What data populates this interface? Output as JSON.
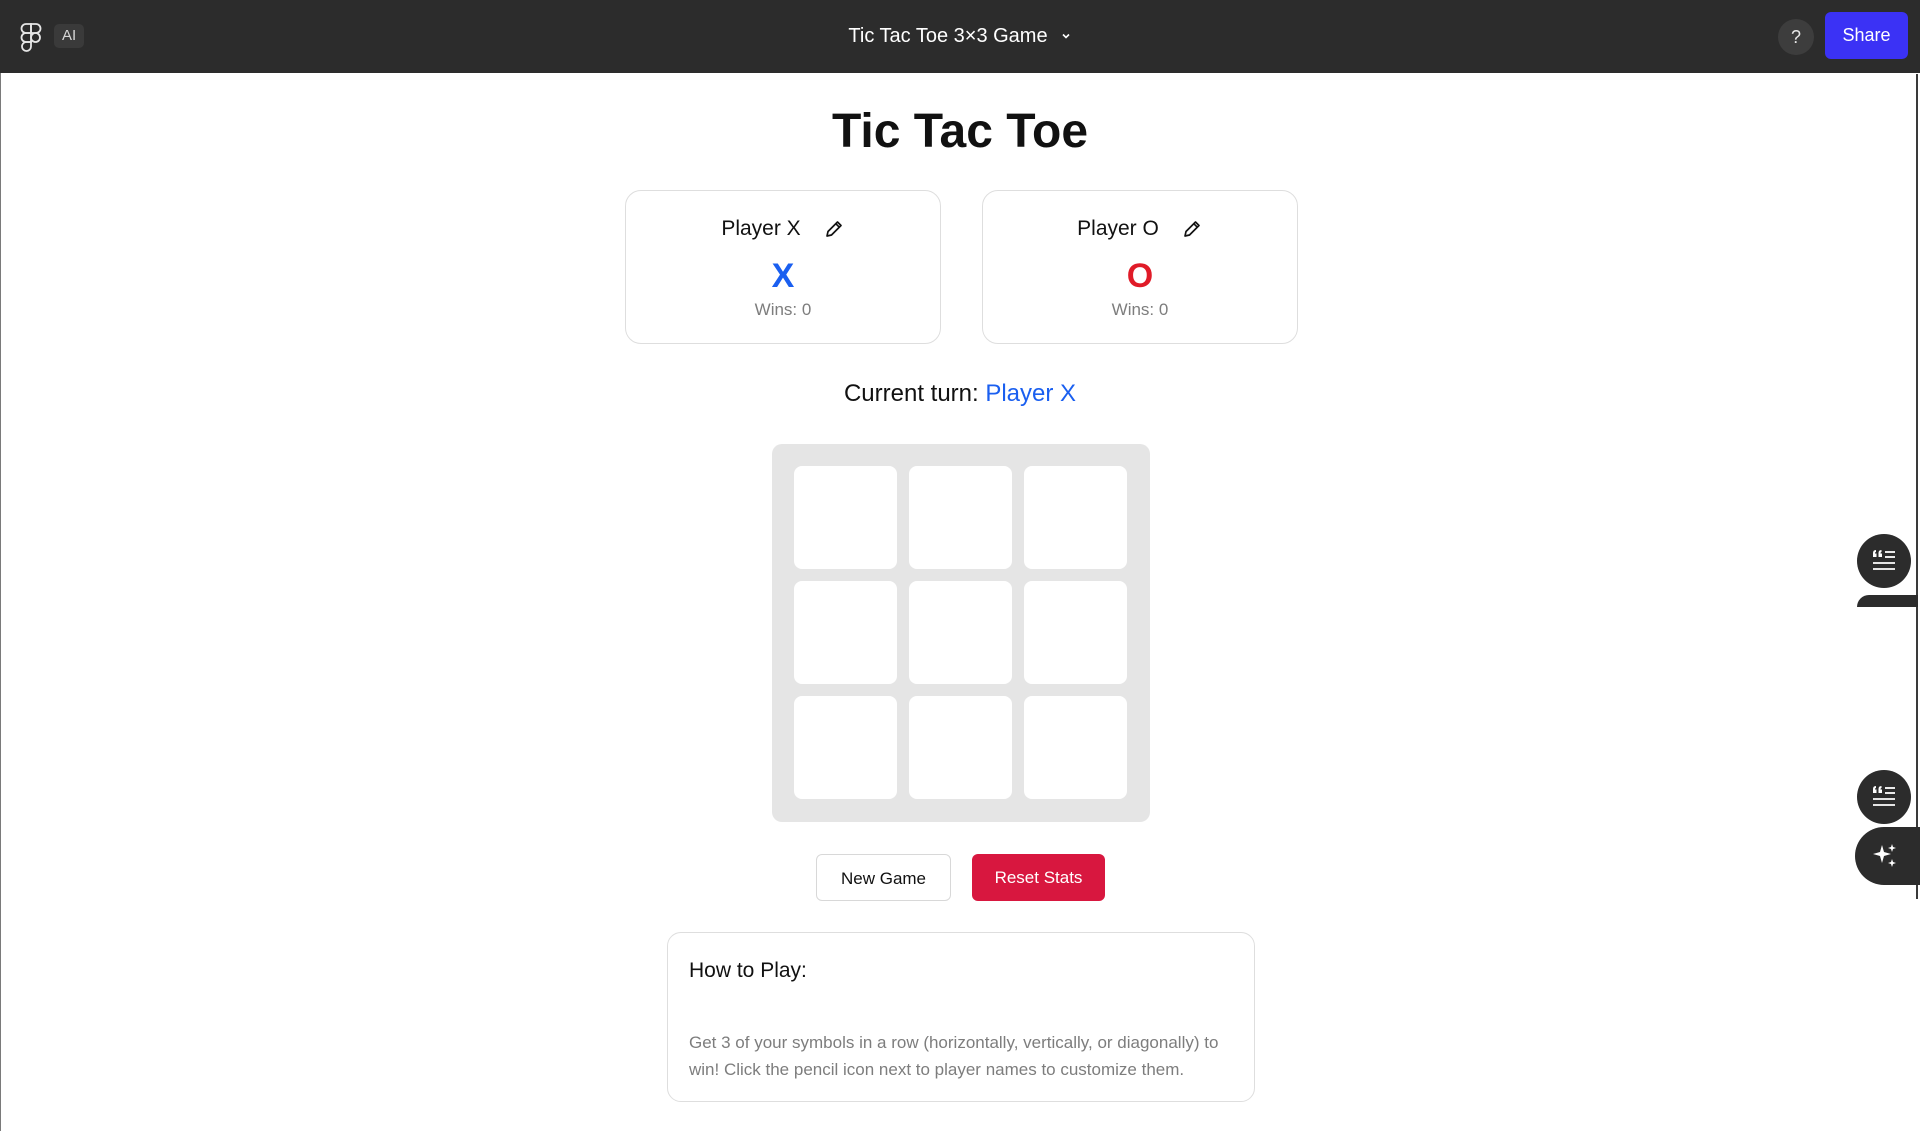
{
  "topbar": {
    "ai_label": "AI",
    "doc_title": "Tic Tac Toe 3×3 Game",
    "help_label": "?",
    "share_label": "Share"
  },
  "game": {
    "title": "Tic Tac Toe",
    "players": [
      {
        "name": "Player X",
        "symbol": "X",
        "wins_label": "Wins: 0",
        "color": "#1a5ff0"
      },
      {
        "name": "Player O",
        "symbol": "O",
        "wins_label": "Wins: 0",
        "color": "#e01b28"
      }
    ],
    "turn_label": "Current turn:",
    "current_player": "Player X",
    "board": [
      "",
      "",
      "",
      "",
      "",
      "",
      "",
      "",
      ""
    ],
    "new_game_label": "New Game",
    "reset_stats_label": "Reset Stats"
  },
  "howto": {
    "title": "How to Play:",
    "text": "Get 3 of your symbols in a row (horizontally, vertically, or diagonally) to win! Click the pencil icon next to player names to customize them."
  },
  "colors": {
    "accent_blue": "#1a5ff0",
    "accent_red": "#e01b28",
    "reset_button": "#d8173f",
    "share_button": "#3b32f5",
    "topbar": "#2c2c2c"
  },
  "icons": [
    "figma-logo-icon",
    "chevron-down-icon",
    "pencil-icon",
    "comment-list-icon",
    "sparkle-icon"
  ]
}
